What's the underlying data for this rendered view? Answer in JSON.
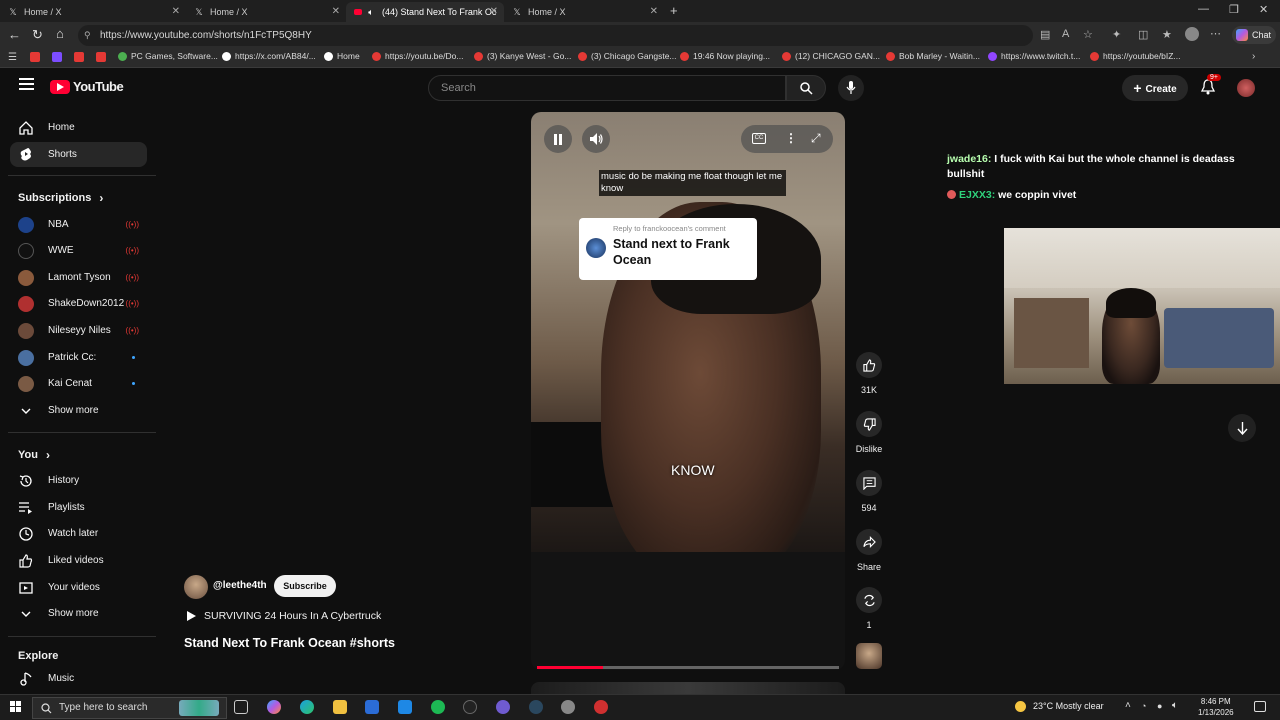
{
  "browser": {
    "tabs": [
      {
        "label": "Home / X",
        "active": false
      },
      {
        "label": "Home / X",
        "active": false
      },
      {
        "label": "(44) Stand Next To Frank Oc",
        "active": true
      },
      {
        "label": "Home / X",
        "active": false
      }
    ],
    "url": "https://www.youtube.com/shorts/n1FcTP5Q8HY",
    "bookmarks": [
      "PC Games, Software...",
      "https://x.com/AB84/...",
      "Home",
      "https://youtu.be/Do...",
      "(3) Kanye West - Go...",
      "(3) Chicago Gangste...",
      "19:46 Now playing...",
      "(12) CHICAGO GAN...",
      "Bob Marley - Waitin...",
      "https://www.twitch.t...",
      "https://youtube/bIZ..."
    ],
    "chat_label": "Chat"
  },
  "header": {
    "logo": "YouTube",
    "search_placeholder": "Search",
    "create_label": "Create",
    "notification_count": "9+"
  },
  "sidebar": {
    "main": [
      {
        "label": "Home",
        "icon": "home-icon"
      },
      {
        "label": "Shorts",
        "icon": "shorts-icon",
        "active": true
      }
    ],
    "subscriptions_title": "Subscriptions",
    "subscriptions": [
      {
        "label": "NBA",
        "status": "live",
        "color": "#1d428a"
      },
      {
        "label": "WWE",
        "status": "live",
        "color": "#111111"
      },
      {
        "label": "Lamont Tyson",
        "status": "live",
        "color": "#8a5a3c"
      },
      {
        "label": "ShakeDown2012",
        "status": "live",
        "color": "#b03030"
      },
      {
        "label": "Nileseyy Niles",
        "status": "live",
        "color": "#6b4a3a"
      },
      {
        "label": "Patrick Cc:",
        "status": "new",
        "color": "#4a6fa0"
      },
      {
        "label": "Kai Cenat",
        "status": "new",
        "color": "#7a5a44"
      }
    ],
    "show_more": "Show more",
    "you_title": "You",
    "you_items": [
      {
        "label": "History",
        "icon": "history-icon"
      },
      {
        "label": "Playlists",
        "icon": "playlists-icon"
      },
      {
        "label": "Watch later",
        "icon": "watch-later-icon"
      },
      {
        "label": "Liked videos",
        "icon": "liked-icon"
      },
      {
        "label": "Your videos",
        "icon": "your-videos-icon"
      }
    ],
    "show_more_2": "Show more",
    "explore_title": "Explore",
    "explore_items": [
      {
        "label": "Music",
        "icon": "music-icon"
      }
    ]
  },
  "video": {
    "caption_top": "music do be making me float though let me know",
    "reply_small": "Reply to franckoocean's comment",
    "reply_title": "Stand next to Frank Ocean",
    "subtitle": "KNOW",
    "progress": 0.22,
    "cc_label": "CC"
  },
  "actions": {
    "likes": "31K",
    "dislike": "Dislike",
    "comments": "594",
    "share": "Share",
    "remix": "1"
  },
  "channel": {
    "handle": "@leethe4th",
    "subscribe": "Subscribe",
    "playlist": "SURVIVING 24 Hours In A Cybertruck",
    "title": "Stand Next To Frank Ocean #shorts"
  },
  "stream_chat": [
    {
      "user": "jwade16:",
      "text": " I fuck with Kai but the whole channel is deadass bullshit",
      "color": "#b8ffb0"
    },
    {
      "user": "EJXX3:",
      "text": " we coppin vivet",
      "color": "#2fd27c"
    }
  ],
  "taskbar": {
    "search_placeholder": "Type here to search",
    "weather": "23°C  Mostly clear",
    "time": "8:46 PM",
    "date": "1/13/2026"
  },
  "colors": {
    "accent": "#ff0033",
    "background": "#0f0f0f",
    "live": "#e53935",
    "new": "#3ea6ff"
  }
}
